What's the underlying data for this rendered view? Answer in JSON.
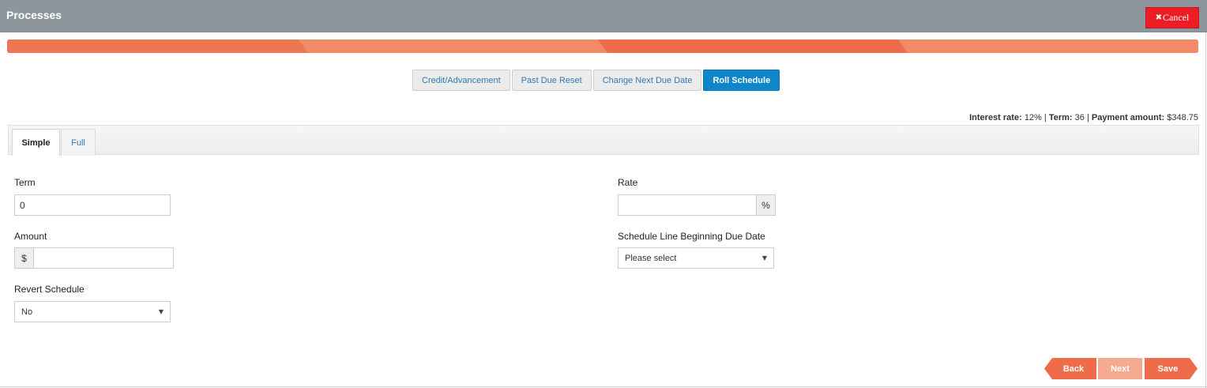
{
  "header": {
    "title": "Processes",
    "cancel_label": "Cancel",
    "cancel_icon": "close-icon"
  },
  "progress": {
    "steps": 4,
    "colors": [
      "#ee7753",
      "#f28a68"
    ]
  },
  "actions": [
    {
      "label": "Credit/Advancement",
      "active": false
    },
    {
      "label": "Past Due Reset",
      "active": false
    },
    {
      "label": "Change Next Due Date",
      "active": false
    },
    {
      "label": "Roll Schedule",
      "active": true
    }
  ],
  "summary": {
    "interest_label": "Interest rate:",
    "interest_value": "12%",
    "term_label": "Term:",
    "term_value": "36",
    "payment_label": "Payment amount:",
    "payment_value": "$348.75",
    "separator": "|"
  },
  "tabs": [
    {
      "label": "Simple",
      "active": true
    },
    {
      "label": "Full",
      "active": false
    }
  ],
  "form": {
    "term": {
      "label": "Term",
      "value": "0"
    },
    "rate": {
      "label": "Rate",
      "value": "",
      "suffix": "%"
    },
    "amount": {
      "label": "Amount",
      "value": "",
      "prefix": "$"
    },
    "schedule_line": {
      "label": "Schedule Line Beginning Due Date",
      "selected": "Please select"
    },
    "revert": {
      "label": "Revert Schedule",
      "selected": "No"
    }
  },
  "nav": {
    "back_label": "Back",
    "next_label": "Next",
    "save_label": "Save"
  },
  "colors": {
    "header_bg": "#8c969c",
    "cancel_bg": "#ee1d23",
    "accent": "#ee6c4a",
    "active_button": "#0f86c9",
    "link": "#2d7ab5"
  }
}
